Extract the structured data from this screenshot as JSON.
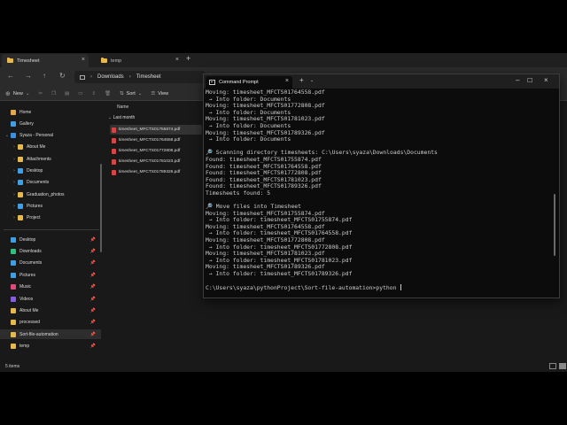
{
  "explorer": {
    "tabs": [
      {
        "label": "Timesheet",
        "active": true
      },
      {
        "label": "temp",
        "active": false
      }
    ],
    "breadcrumb": [
      "Downloads",
      "Timesheet"
    ],
    "toolbar": {
      "new_label": "New",
      "sort_label": "Sort",
      "view_label": "View"
    },
    "sidebar": {
      "items": [
        {
          "label": "Home",
          "icon": "home-icon",
          "color": "#e3a64a"
        },
        {
          "label": "Gallery",
          "icon": "gallery-icon",
          "color": "#3fa0e6"
        },
        {
          "label": "Syaza - Personal",
          "icon": "cloud-icon",
          "color": "#3b8fe0"
        },
        {
          "label": "About Me",
          "icon": "folder-icon",
          "color": "#e8b94a"
        },
        {
          "label": "Attachments",
          "icon": "folder-icon",
          "color": "#e8b94a"
        },
        {
          "label": "Desktop",
          "icon": "desktop-icon",
          "color": "#3fa0e6"
        },
        {
          "label": "Documents",
          "icon": "documents-icon",
          "color": "#3fa0e6"
        },
        {
          "label": "Graduation_photos",
          "icon": "folder-icon",
          "color": "#e8b94a"
        },
        {
          "label": "Pictures",
          "icon": "pictures-icon",
          "color": "#3fa0e6"
        },
        {
          "label": "Project",
          "icon": "folder-icon",
          "color": "#e8b94a"
        }
      ],
      "quick": [
        {
          "label": "Desktop",
          "icon": "desktop-icon",
          "color": "#3fa0e6"
        },
        {
          "label": "Downloads",
          "icon": "downloads-icon",
          "color": "#2ec27e"
        },
        {
          "label": "Documents",
          "icon": "documents-icon",
          "color": "#3fa0e6"
        },
        {
          "label": "Pictures",
          "icon": "pictures-icon",
          "color": "#3fa0e6"
        },
        {
          "label": "Music",
          "icon": "music-icon",
          "color": "#e0497a"
        },
        {
          "label": "Videos",
          "icon": "videos-icon",
          "color": "#8a5ce6"
        },
        {
          "label": "About Me",
          "icon": "folder-icon",
          "color": "#e8b94a"
        },
        {
          "label": "processed",
          "icon": "folder-icon",
          "color": "#e8b94a"
        },
        {
          "label": "Sort-file-automation",
          "icon": "folder-icon",
          "color": "#e8b94a"
        },
        {
          "label": "temp",
          "icon": "folder-icon",
          "color": "#e8b94a"
        }
      ]
    },
    "main": {
      "column_name": "Name",
      "group_label": "Last month",
      "files": [
        "timesheet_MFCTS01755874.pdf",
        "timesheet_MFCTS01764558.pdf",
        "timesheet_MFCTS01772808.pdf",
        "timesheet_MFCTS01781023.pdf",
        "timesheet_MFCTS01789326.pdf"
      ]
    },
    "status": "5 items"
  },
  "terminal": {
    "title": "Command Prompt",
    "lines": [
      "Moving: timesheet_MFCTS01764558.pdf",
      " → Into folder: Documents",
      "Moving: timesheet_MFCTS01772808.pdf",
      " → Into folder: Documents",
      "Moving: timesheet_MFCTS01781023.pdf",
      " → Into folder: Documents",
      "Moving: timesheet_MFCTS01789326.pdf",
      " → Into folder: Documents",
      "",
      "🔎 Scanning directory timesheets: C:\\Users\\syaza\\Downloads\\Documents",
      "Found: timesheet_MFCTS01755874.pdf",
      "Found: timesheet_MFCTS01764558.pdf",
      "Found: timesheet_MFCTS01772808.pdf",
      "Found: timesheet_MFCTS01781023.pdf",
      "Found: timesheet_MFCTS01789326.pdf",
      "Timesheets found: 5",
      "",
      "🔎 Move files into Timesheet",
      "Moving: timesheet_MFCTS01755874.pdf",
      " → Into folder: timesheet_MFCTS01755874.pdf",
      "Moving: timesheet_MFCTS01764558.pdf",
      " → Into folder: timesheet_MFCTS01764558.pdf",
      "Moving: timesheet_MFCTS01772808.pdf",
      " → Into folder: timesheet_MFCTS01772808.pdf",
      "Moving: timesheet_MFCTS01781023.pdf",
      " → Into folder: timesheet_MFCTS01781023.pdf",
      "Moving: timesheet_MFCTS01789326.pdf",
      " → Into folder: timesheet_MFCTS01789326.pdf",
      ""
    ],
    "prompt": "C:\\Users\\syaza\\pythonProject\\Sort-file-automation>python "
  }
}
